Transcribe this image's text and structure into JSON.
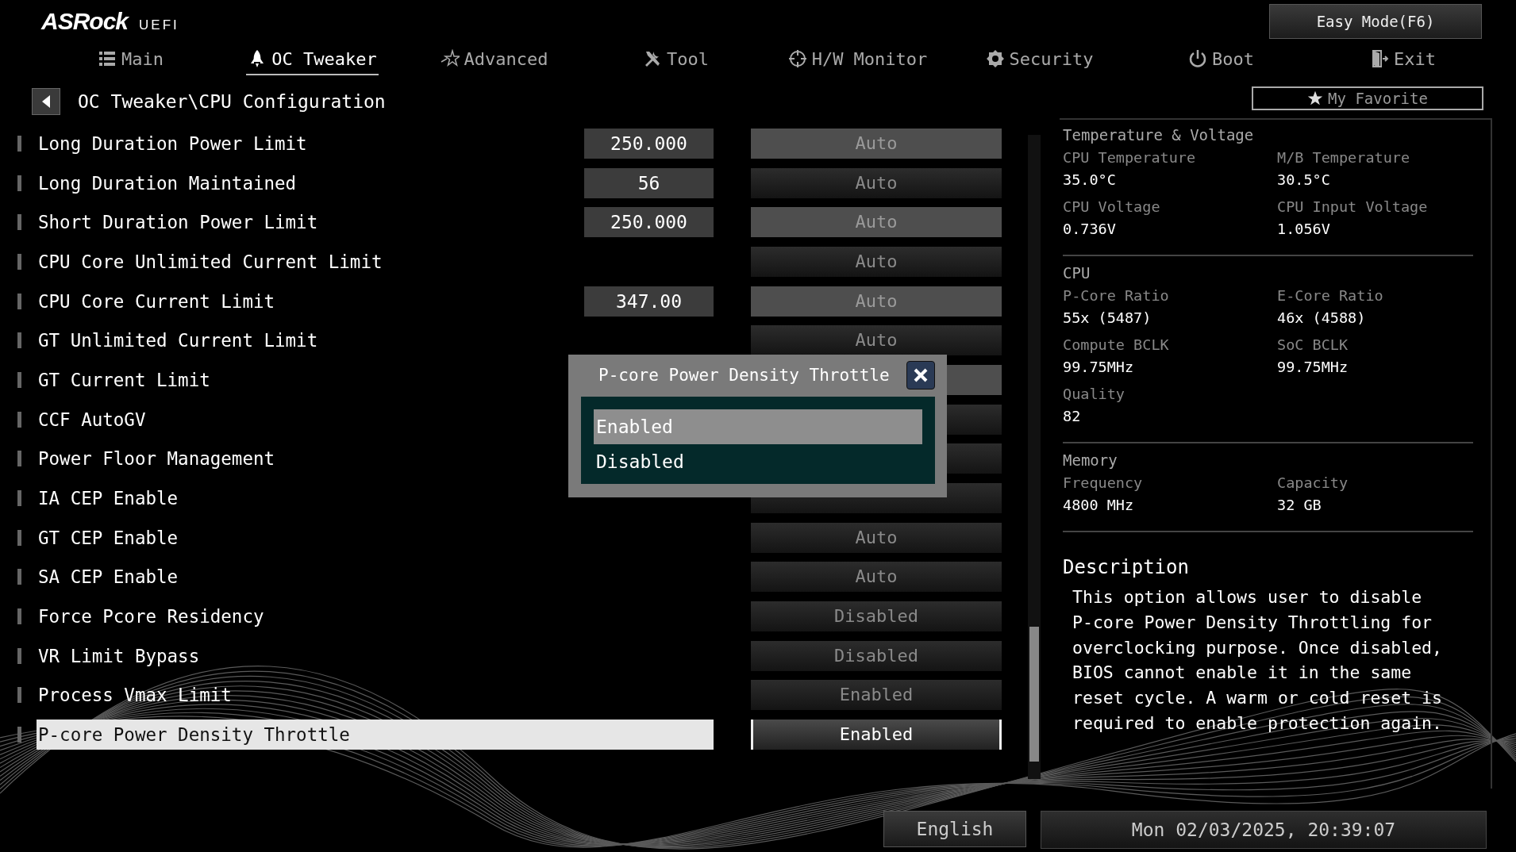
{
  "header": {
    "logo": "ASRock",
    "logo_suffix": "UEFI",
    "easy_mode_button": "Easy Mode(F6)"
  },
  "tabs": [
    {
      "label": "Main",
      "selected": false
    },
    {
      "label": "OC Tweaker",
      "selected": true
    },
    {
      "label": "Advanced",
      "selected": false
    },
    {
      "label": "Tool",
      "selected": false
    },
    {
      "label": "H/W Monitor",
      "selected": false
    },
    {
      "label": "Security",
      "selected": false
    },
    {
      "label": "Boot",
      "selected": false
    },
    {
      "label": "Exit",
      "selected": false
    }
  ],
  "breadcrumb": "OC Tweaker\\CPU Configuration",
  "favorite_button": "My Favorite",
  "settings": [
    {
      "label": "Long Duration Power Limit",
      "value": "250.000",
      "option": "Auto",
      "disabled": true,
      "selected": false
    },
    {
      "label": "Long Duration Maintained",
      "value": "56",
      "option": "Auto",
      "disabled": false,
      "selected": false
    },
    {
      "label": "Short Duration Power Limit",
      "value": "250.000",
      "option": "Auto",
      "disabled": true,
      "selected": false
    },
    {
      "label": "CPU Core Unlimited Current Limit",
      "option": "Auto",
      "disabled": false,
      "selected": false
    },
    {
      "label": "CPU Core Current Limit",
      "value": "347.00",
      "option": "Auto",
      "disabled": true,
      "selected": false
    },
    {
      "label": "GT Unlimited Current Limit",
      "option": "Auto",
      "disabled": false,
      "selected": false
    },
    {
      "label": "GT Current Limit",
      "disabled": true,
      "selected": false
    },
    {
      "label": "CCF AutoGV",
      "disabled": false,
      "selected": false
    },
    {
      "label": "Power Floor Management",
      "disabled": false,
      "selected": false
    },
    {
      "label": "IA CEP Enable",
      "disabled": false,
      "selected": false
    },
    {
      "label": "GT CEP Enable",
      "option": "Auto",
      "disabled": false,
      "selected": false
    },
    {
      "label": "SA CEP Enable",
      "option": "Auto",
      "disabled": false,
      "selected": false
    },
    {
      "label": "Force Pcore Residency",
      "option": "Disabled",
      "disabled": false,
      "selected": false
    },
    {
      "label": "VR Limit Bypass",
      "option": "Disabled",
      "disabled": false,
      "selected": false
    },
    {
      "label": "Process Vmax Limit",
      "option": "Enabled",
      "disabled": false,
      "selected": false
    },
    {
      "label": "P-core Power Density Throttle",
      "option": "Enabled",
      "disabled": false,
      "selected": true
    }
  ],
  "popup": {
    "title": "P-core Power Density Throttle",
    "options": [
      {
        "label": "Enabled",
        "selected": true
      },
      {
        "label": "Disabled",
        "selected": false
      }
    ]
  },
  "info_panel": [
    {
      "title": "Temperature & Voltage",
      "items": [
        {
          "label": "CPU Temperature",
          "value": "35.0°C"
        },
        {
          "label": "M/B Temperature",
          "value": "30.5°C"
        },
        {
          "label": "CPU Voltage",
          "value": "0.736V"
        },
        {
          "label": "CPU Input Voltage",
          "value": "1.056V"
        }
      ]
    },
    {
      "title": "CPU",
      "items": [
        {
          "label": "P-Core Ratio",
          "value": "55x (5487)"
        },
        {
          "label": "E-Core Ratio",
          "value": "46x (4588)"
        },
        {
          "label": "Compute BCLK",
          "value": "99.75MHz"
        },
        {
          "label": "SoC BCLK",
          "value": "99.75MHz"
        },
        {
          "label": "Quality",
          "value": "82"
        }
      ]
    },
    {
      "title": "Memory",
      "items": [
        {
          "label": "Frequency",
          "value": "4800 MHz"
        },
        {
          "label": "Capacity",
          "value": "32 GB"
        }
      ]
    }
  ],
  "description": {
    "title": "Description",
    "text": "This option allows user to disable P-core Power Density Throttling for overclocking purpose. Once disabled, BIOS cannot enable it in the same reset cycle. A warm or cold reset is required to enable protection again."
  },
  "footer": {
    "language": "English",
    "datetime": "Mon 02/03/2025, 20:39:07"
  }
}
